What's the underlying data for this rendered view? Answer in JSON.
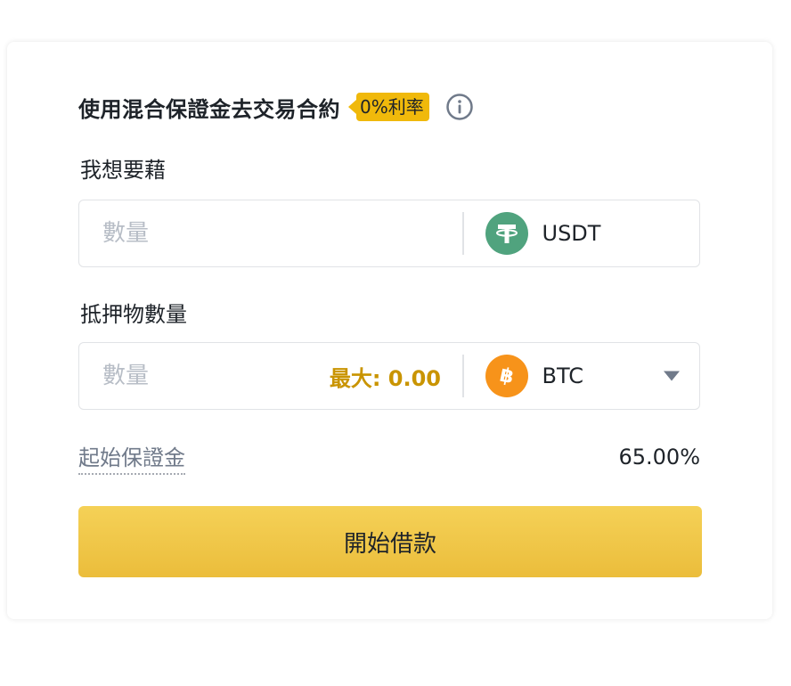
{
  "header": {
    "title": "使用混合保證金去交易合約",
    "rate_badge": "0%利率",
    "info_icon": "info-circle-icon"
  },
  "borrow": {
    "label": "我想要藉",
    "placeholder": "數量",
    "coin": "USDT",
    "coin_icon": "tether-icon",
    "coin_color": "#50a37e"
  },
  "collateral": {
    "label": "抵押物數量",
    "placeholder": "數量",
    "max_label": "最大: 0.00",
    "coin": "BTC",
    "coin_icon": "bitcoin-icon",
    "coin_color": "#f7931a",
    "dropdown_icon": "caret-down-icon"
  },
  "initial_margin": {
    "label": "起始保證金",
    "value": "65.00%"
  },
  "submit": {
    "label": "開始借款"
  },
  "colors": {
    "accent": "#f0b90b",
    "max_text": "#c99400",
    "text_primary": "#1e2329",
    "text_secondary": "#707a8a"
  }
}
